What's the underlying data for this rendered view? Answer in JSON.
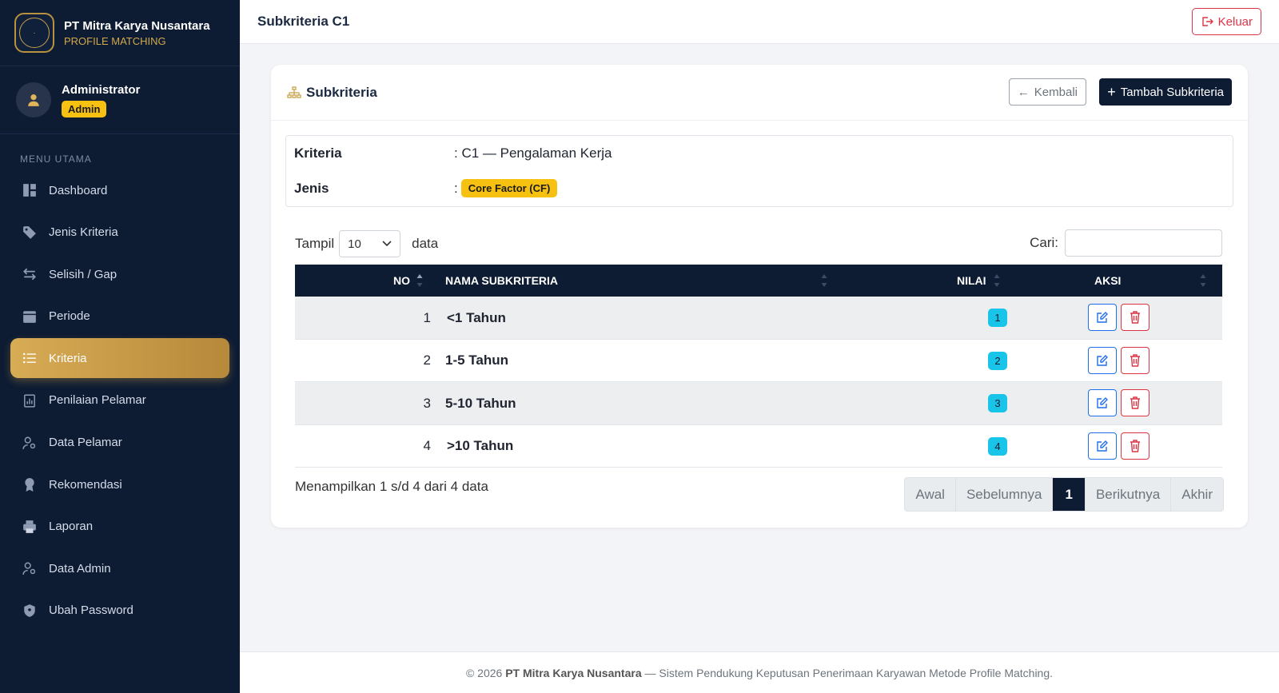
{
  "brand": {
    "title": "PT Mitra Karya Nusantara",
    "subtitle": "PROFILE MATCHING"
  },
  "user": {
    "name": "Administrator",
    "role": "Admin"
  },
  "menu": {
    "heading": "MENU UTAMA",
    "items": [
      {
        "label": "Dashboard",
        "icon": "dashboard-icon"
      },
      {
        "label": "Jenis Kriteria",
        "icon": "tag-icon"
      },
      {
        "label": "Selisih / Gap",
        "icon": "arrows-exchange-icon"
      },
      {
        "label": "Periode",
        "icon": "calendar-icon"
      },
      {
        "label": "Kriteria",
        "icon": "list-icon",
        "active": true
      },
      {
        "label": "Penilaian Pelamar",
        "icon": "clipboard-chart-icon"
      },
      {
        "label": "Data Pelamar",
        "icon": "user-gear-icon"
      },
      {
        "label": "Rekomendasi",
        "icon": "award-icon"
      },
      {
        "label": "Laporan",
        "icon": "printer-icon"
      },
      {
        "label": "Data Admin",
        "icon": "user-gear-icon"
      },
      {
        "label": "Ubah Password",
        "icon": "shield-icon"
      }
    ]
  },
  "header": {
    "title": "Subkriteria C1",
    "logout_label": "Keluar"
  },
  "card": {
    "title": "Subkriteria",
    "back_label": "Kembali",
    "add_label": "Tambah Subkriteria"
  },
  "info": {
    "kriteria_label": "Kriteria",
    "kriteria_value": ": C1 — Pengalaman Kerja",
    "jenis_label": "Jenis",
    "jenis_sep": ":",
    "jenis_value": "Core Factor (CF)"
  },
  "controls": {
    "show_label": "Tampil",
    "show_value": "10",
    "data_label": "data",
    "search_label": "Cari:",
    "search_value": ""
  },
  "table": {
    "columns": [
      "NO",
      "NAMA SUBKRITERIA",
      "NILAI",
      "AKSI"
    ],
    "rows": [
      {
        "no": "1",
        "name": "<1 Tahun",
        "nilai": "1"
      },
      {
        "no": "2",
        "name": "1-5 Tahun",
        "nilai": "2"
      },
      {
        "no": "3",
        "name": "5-10 Tahun",
        "nilai": "3"
      },
      {
        "no": "4",
        "name": ">10 Tahun",
        "nilai": "4"
      }
    ]
  },
  "summary": "Menampilkan 1 s/d 4 dari 4 data",
  "pagination": {
    "first": "Awal",
    "prev": "Sebelumnya",
    "current": "1",
    "next": "Berikutnya",
    "last": "Akhir"
  },
  "footer": {
    "prefix": "© 2026",
    "company": "PT Mitra Karya Nusantara",
    "suffix": "— Sistem Pendukung Keputusan Penerimaan Karyawan Metode Profile Matching."
  },
  "colors": {
    "navy": "#0d1b33",
    "gold": "#c9a24a",
    "badge_yellow": "#f7c112",
    "badge_cyan": "#18c4e8",
    "danger": "#dc3545",
    "primary": "#1f6feb"
  }
}
